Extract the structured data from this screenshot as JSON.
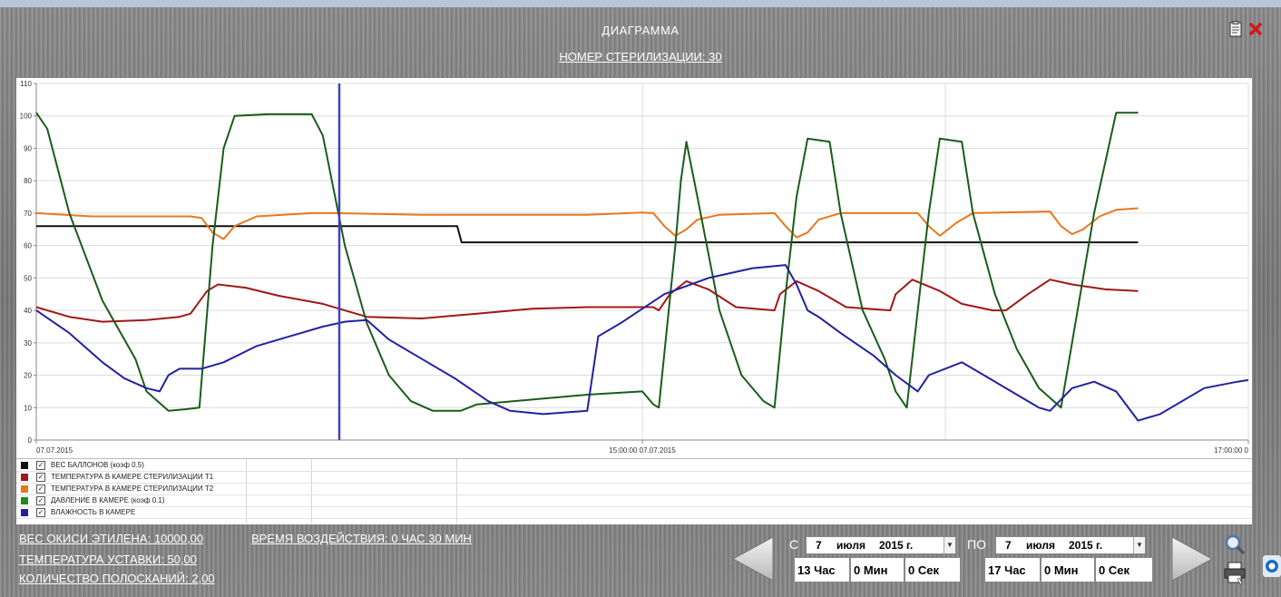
{
  "window": {
    "title": "ДИАГРАММА",
    "subtitle": "НОМЕР СТЕРИЛИЗАЦИИ:  30"
  },
  "chart_data": {
    "type": "line",
    "ylim": [
      0,
      110
    ],
    "yticks": [
      0,
      10,
      20,
      30,
      40,
      50,
      60,
      70,
      80,
      90,
      100,
      110
    ],
    "x_tick_labels": [
      "07.07.2015",
      "15:00:00 07.07.2015",
      "17:00:00 0"
    ],
    "series": [
      {
        "name": "ВЕС БАЛЛОНОВ (коэф 0.5)",
        "color": "#101010",
        "points": [
          [
            0,
            66
          ],
          [
            0.382,
            66
          ],
          [
            0.386,
            61
          ],
          [
            1,
            61
          ]
        ]
      },
      {
        "name": "ТЕМПЕРАТУРА В КАМЕРЕ СТЕРИЛИЗАЦИИ Т1",
        "color": "#a01818",
        "points": [
          [
            0,
            41
          ],
          [
            0.03,
            38
          ],
          [
            0.06,
            36.5
          ],
          [
            0.1,
            37
          ],
          [
            0.13,
            38
          ],
          [
            0.14,
            39
          ],
          [
            0.155,
            46
          ],
          [
            0.165,
            48
          ],
          [
            0.19,
            47
          ],
          [
            0.22,
            44.5
          ],
          [
            0.26,
            42
          ],
          [
            0.28,
            40
          ],
          [
            0.3,
            38
          ],
          [
            0.35,
            37.5
          ],
          [
            0.4,
            39
          ],
          [
            0.45,
            40.5
          ],
          [
            0.5,
            41
          ],
          [
            0.56,
            41
          ],
          [
            0.565,
            40
          ],
          [
            0.575,
            45
          ],
          [
            0.59,
            49
          ],
          [
            0.61,
            46.5
          ],
          [
            0.635,
            41
          ],
          [
            0.67,
            40
          ],
          [
            0.675,
            45
          ],
          [
            0.69,
            49
          ],
          [
            0.71,
            46
          ],
          [
            0.735,
            41
          ],
          [
            0.775,
            40
          ],
          [
            0.78,
            45
          ],
          [
            0.795,
            49.5
          ],
          [
            0.82,
            46
          ],
          [
            0.84,
            42
          ],
          [
            0.868,
            40
          ],
          [
            0.88,
            40
          ],
          [
            0.9,
            45
          ],
          [
            0.92,
            49.5
          ],
          [
            0.94,
            48
          ],
          [
            0.97,
            46.5
          ],
          [
            1,
            46
          ]
        ]
      },
      {
        "name": "ТЕМПЕРАТУРА В КАМЕРЕ СТЕРИЛИЗАЦИИ Т2",
        "color": "#e8781e",
        "points": [
          [
            0,
            70
          ],
          [
            0.05,
            69
          ],
          [
            0.14,
            69
          ],
          [
            0.15,
            68.5
          ],
          [
            0.16,
            64
          ],
          [
            0.17,
            62
          ],
          [
            0.18,
            66
          ],
          [
            0.2,
            69
          ],
          [
            0.25,
            70
          ],
          [
            0.27,
            70
          ],
          [
            0.35,
            69.5
          ],
          [
            0.5,
            69.5
          ],
          [
            0.55,
            70.2
          ],
          [
            0.56,
            70
          ],
          [
            0.57,
            66
          ],
          [
            0.58,
            63
          ],
          [
            0.59,
            65
          ],
          [
            0.6,
            68
          ],
          [
            0.62,
            69.5
          ],
          [
            0.67,
            70
          ],
          [
            0.68,
            66
          ],
          [
            0.69,
            62.5
          ],
          [
            0.7,
            64
          ],
          [
            0.71,
            68
          ],
          [
            0.73,
            70
          ],
          [
            0.8,
            70
          ],
          [
            0.81,
            66
          ],
          [
            0.82,
            63
          ],
          [
            0.835,
            67
          ],
          [
            0.85,
            70
          ],
          [
            0.92,
            70.5
          ],
          [
            0.93,
            66
          ],
          [
            0.94,
            63.5
          ],
          [
            0.95,
            65
          ],
          [
            0.965,
            69
          ],
          [
            0.98,
            71
          ],
          [
            1,
            71.5
          ]
        ]
      },
      {
        "name": "ДАВЛЕНИЕ В КАМЕРЕ (коэф 0.1)",
        "color": "#1a5c1a",
        "points": [
          [
            0,
            101
          ],
          [
            0.01,
            96
          ],
          [
            0.03,
            70
          ],
          [
            0.06,
            43
          ],
          [
            0.09,
            25
          ],
          [
            0.1,
            15
          ],
          [
            0.12,
            9
          ],
          [
            0.135,
            9.5
          ],
          [
            0.148,
            10
          ],
          [
            0.16,
            60
          ],
          [
            0.17,
            90
          ],
          [
            0.18,
            100
          ],
          [
            0.21,
            100.5
          ],
          [
            0.25,
            100.5
          ],
          [
            0.26,
            94
          ],
          [
            0.28,
            60
          ],
          [
            0.3,
            36
          ],
          [
            0.32,
            20
          ],
          [
            0.34,
            12
          ],
          [
            0.36,
            9
          ],
          [
            0.385,
            9
          ],
          [
            0.4,
            11
          ],
          [
            0.5,
            14
          ],
          [
            0.55,
            15
          ],
          [
            0.56,
            11
          ],
          [
            0.565,
            10
          ],
          [
            0.58,
            60
          ],
          [
            0.585,
            80
          ],
          [
            0.59,
            92
          ],
          [
            0.6,
            75
          ],
          [
            0.62,
            40
          ],
          [
            0.64,
            20
          ],
          [
            0.66,
            12
          ],
          [
            0.67,
            10
          ],
          [
            0.68,
            45
          ],
          [
            0.69,
            75
          ],
          [
            0.7,
            93
          ],
          [
            0.72,
            92
          ],
          [
            0.73,
            70
          ],
          [
            0.75,
            40
          ],
          [
            0.77,
            25
          ],
          [
            0.78,
            15
          ],
          [
            0.79,
            10
          ],
          [
            0.8,
            40
          ],
          [
            0.81,
            70
          ],
          [
            0.82,
            93
          ],
          [
            0.84,
            92
          ],
          [
            0.85,
            70
          ],
          [
            0.87,
            45
          ],
          [
            0.89,
            28
          ],
          [
            0.91,
            16
          ],
          [
            0.93,
            10
          ],
          [
            0.94,
            30
          ],
          [
            0.96,
            70
          ],
          [
            0.98,
            101
          ],
          [
            1,
            101
          ]
        ]
      },
      {
        "name": "ВЛАЖНОСТЬ В КАМЕРЕ",
        "color": "#22229e",
        "points": [
          [
            0,
            40
          ],
          [
            0.03,
            33
          ],
          [
            0.06,
            24
          ],
          [
            0.08,
            19
          ],
          [
            0.1,
            16
          ],
          [
            0.112,
            15
          ],
          [
            0.12,
            20
          ],
          [
            0.13,
            22
          ],
          [
            0.15,
            22
          ],
          [
            0.17,
            24
          ],
          [
            0.2,
            29
          ],
          [
            0.23,
            32
          ],
          [
            0.26,
            35
          ],
          [
            0.28,
            36.5
          ],
          [
            0.3,
            37
          ],
          [
            0.32,
            31
          ],
          [
            0.35,
            25
          ],
          [
            0.38,
            19
          ],
          [
            0.41,
            12
          ],
          [
            0.43,
            9
          ],
          [
            0.46,
            8
          ],
          [
            0.5,
            9
          ],
          [
            0.51,
            32
          ],
          [
            0.53,
            36
          ],
          [
            0.57,
            45
          ],
          [
            0.61,
            50
          ],
          [
            0.65,
            53
          ],
          [
            0.68,
            54
          ],
          [
            0.69,
            48
          ],
          [
            0.7,
            40
          ],
          [
            0.71,
            38
          ],
          [
            0.73,
            33
          ],
          [
            0.76,
            26
          ],
          [
            0.78,
            20
          ],
          [
            0.8,
            15
          ],
          [
            0.81,
            20
          ],
          [
            0.84,
            24
          ],
          [
            0.86,
            20
          ],
          [
            0.89,
            14
          ],
          [
            0.91,
            10
          ],
          [
            0.92,
            9
          ],
          [
            0.94,
            16
          ],
          [
            0.96,
            18
          ],
          [
            0.98,
            15
          ],
          [
            1,
            6
          ],
          [
            1.02,
            8
          ],
          [
            1.06,
            16
          ],
          [
            1.09,
            18
          ],
          [
            1.1,
            18.5
          ]
        ]
      }
    ],
    "cursor": {
      "x": 0.25,
      "color": "#4040c0"
    },
    "grid": true,
    "legend_placement": "bottom-left"
  },
  "legend": {
    "items": [
      {
        "label": "ВЕС БАЛЛОНОВ (коэф 0.5)",
        "checked": "✓",
        "color": "#101010"
      },
      {
        "label": "ТЕМПЕРАТУРА В КАМЕРЕ СТЕРИЛИЗАЦИИ Т1",
        "checked": "✓",
        "color": "#a01818"
      },
      {
        "label": "ТЕМПЕРАТУРА В КАМЕРЕ СТЕРИЛИЗАЦИИ Т2",
        "checked": "✓",
        "color": "#e8781e"
      },
      {
        "label": "ДАВЛЕНИЕ В КАМЕРЕ (коэф 0.1)",
        "checked": "✓",
        "color": "#1a8c1a"
      },
      {
        "label": "ВЛАЖНОСТЬ В КАМЕРЕ",
        "checked": "✓",
        "color": "#22229e"
      }
    ]
  },
  "info": {
    "ethylene_oxide": "ВЕС ОКИСИ ЭТИЛЕНА:  10000,00",
    "setpoint_temp": "ТЕМПЕРАТУРА УСТАВКИ:  50,00",
    "rinse_count": "КОЛИЧЕСТВО ПОЛОСКАНИЙ:  2,00",
    "exposure_time": "ВРЕМЯ ВОЗДЕЙСТВИЯ:  0 ЧАС 30 МИН"
  },
  "range": {
    "from_label": "С",
    "to_label": "ПО",
    "from": {
      "day": "7",
      "month": "июля",
      "year": "2015 г.",
      "hour": "13 Час",
      "minute": "0 Мин",
      "second": "0 Сек"
    },
    "to": {
      "day": "7",
      "month": "июля",
      "year": "2015 г.",
      "hour": "17 Час",
      "minute": "0 Мин",
      "second": "0 Сек"
    }
  },
  "icons": {
    "clipboard": "clipboard-icon",
    "close": "close-icon",
    "prev": "arrow-left-icon",
    "next": "arrow-right-icon",
    "zoom": "magnifier-icon",
    "print": "printer-icon",
    "side": "app-icon"
  }
}
